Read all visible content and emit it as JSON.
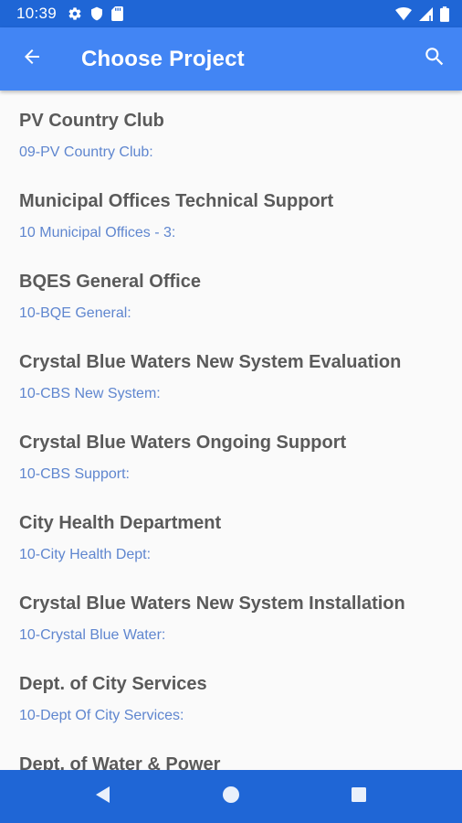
{
  "status_bar": {
    "time": "10:39",
    "left_icons": [
      "gear-icon",
      "shield-icon",
      "sd-card-icon"
    ],
    "right_icons": [
      "wifi-icon",
      "signal-icon",
      "battery-icon"
    ]
  },
  "app_bar": {
    "title": "Choose Project",
    "back_icon": "arrow-left-icon",
    "search_icon": "search-icon",
    "color": "#4285f4"
  },
  "projects": [
    {
      "name": "PV Country Club",
      "code": "09-PV Country Club:"
    },
    {
      "name": "Municipal Offices Technical Support",
      "code": "10 Municipal Offices - 3:"
    },
    {
      "name": "BQES General Office",
      "code": "10-BQE General:"
    },
    {
      "name": "Crystal Blue Waters New System Evaluation",
      "code": "10-CBS New System:"
    },
    {
      "name": "Crystal Blue Waters Ongoing Support",
      "code": "10-CBS Support:"
    },
    {
      "name": "City Health Department",
      "code": "10-City Health Dept:"
    },
    {
      "name": "Crystal Blue Waters New System Installation",
      "code": "10-Crystal Blue Water:"
    },
    {
      "name": "Dept. of City Services",
      "code": "10-Dept Of City Services:"
    },
    {
      "name": "Dept. of Water & Power",
      "code": ""
    }
  ],
  "nav_bar": {
    "buttons": [
      "back-triangle-icon",
      "home-circle-icon",
      "recents-square-icon"
    ],
    "color": "#1f66d6"
  }
}
